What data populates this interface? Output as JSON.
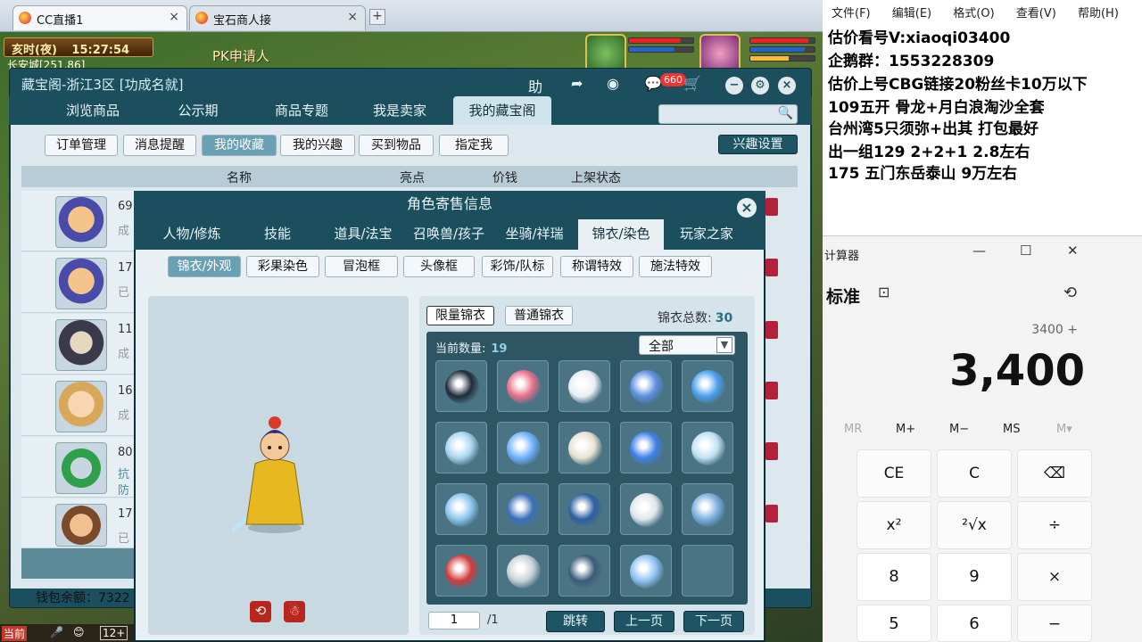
{
  "browser": {
    "tabs": [
      {
        "label": "CC直播1"
      },
      {
        "label": "宝石商人接"
      }
    ],
    "new_tab": "+",
    "close": "×"
  },
  "game": {
    "clock": {
      "period": "亥时(夜)",
      "time": "15:27:54"
    },
    "location": "长安城[251,86]",
    "pk_text": "PK申请人",
    "bottom_bar": {
      "current": "当前",
      "level": "12+"
    }
  },
  "market": {
    "title": "藏宝阁-浙江3区 [功成名就]",
    "badge_count": "660",
    "title_buttons": {
      "help": "助",
      "share": "➦",
      "stop": "◉",
      "chat": "💬",
      "cart": "🛒",
      "minimize": "−",
      "settings": "⚙",
      "close": "×"
    },
    "tabs": [
      {
        "label": "浏览商品"
      },
      {
        "label": "公示期"
      },
      {
        "label": "商品专题"
      },
      {
        "label": "我是卖家"
      },
      {
        "label": "我的藏宝阁"
      }
    ],
    "sub_buttons": [
      {
        "label": "订单管理"
      },
      {
        "label": "消息提醒"
      },
      {
        "label": "我的收藏"
      },
      {
        "label": "我的兴趣"
      },
      {
        "label": "买到物品"
      },
      {
        "label": "指定我"
      }
    ],
    "interest_settings": "兴趣设置",
    "list_headers": {
      "name": "名称",
      "highlight": "亮点",
      "price": "价钱",
      "status": "上架状态"
    },
    "rows": [
      {
        "t1": "69",
        "t2": "成"
      },
      {
        "t1": "17",
        "t2": "已"
      },
      {
        "t1": "11",
        "t2": "成"
      },
      {
        "t1": "16",
        "t2": "成"
      },
      {
        "t1": "80",
        "t2": "抗 防"
      },
      {
        "t1": "17",
        "t2": "已"
      }
    ],
    "wallet": "钱包余额：7322"
  },
  "dialog": {
    "title": "角色寄售信息",
    "close": "×",
    "tabs": [
      {
        "label": "人物/修炼"
      },
      {
        "label": "技能"
      },
      {
        "label": "道具/法宝"
      },
      {
        "label": "召唤兽/孩子"
      },
      {
        "label": "坐骑/祥瑞"
      },
      {
        "label": "锦衣/染色"
      },
      {
        "label": "玩家之家"
      }
    ],
    "subtabs": [
      {
        "label": "锦衣/外观"
      },
      {
        "label": "彩果染色"
      },
      {
        "label": "冒泡框"
      },
      {
        "label": "头像框"
      },
      {
        "label": "彩饰/队标"
      },
      {
        "label": "称谓特效"
      },
      {
        "label": "施法特效"
      }
    ],
    "preview_buttons": {
      "rotate": "⟲",
      "action": "☃"
    },
    "grid_tabs": [
      {
        "label": "限量锦衣"
      },
      {
        "label": "普通锦衣"
      }
    ],
    "total_label": "锦衣总数:",
    "total_value": "30",
    "current_label": "当前数量:",
    "current_value": "19",
    "filter_value": "全部",
    "pager": {
      "page": "1",
      "total": "/1",
      "jump": "跳转",
      "prev": "上一页",
      "next": "下一页"
    },
    "item_colors": [
      "#1e2b3a",
      "#e86f8a",
      "#e9eef2",
      "#5b8fe0",
      "#4aa0f0",
      "#a9d6f0",
      "#6fb2ff",
      "#e8e2d0",
      "#3f7fe8",
      "#bfe2f2",
      "#8ac6ee",
      "#3a6fb8",
      "#2b5fa0",
      "#dfe6ea",
      "#7bb0e0",
      "#d23a3a",
      "#c9d2d8",
      "#3b5c7a",
      "#8fc2f2",
      ""
    ]
  },
  "notepad": {
    "menu": [
      "文件(F)",
      "编辑(E)",
      "格式(O)",
      "查看(V)",
      "帮助(H)"
    ],
    "lines": [
      "估价看号V:xiaoqi03400",
      "企鹅群：1553228309",
      "估价上号CBG链接20粉丝卡10万以下",
      "109五开 骨龙+月白浪淘沙全套",
      "台州湾5只须弥+出其 打包最好",
      "出一组129 2+2+1   2.8左右",
      "175 五门东岳泰山  9万左右"
    ]
  },
  "calculator": {
    "title": "计算器",
    "window_buttons": {
      "min": "—",
      "max": "☐",
      "close": "✕"
    },
    "mode": "标准",
    "mode_icon": "⊡",
    "history_icon": "⟲",
    "expression": "3400 +",
    "display": "3,400",
    "memory": [
      "MR",
      "M+",
      "M−",
      "MS",
      "M▾"
    ],
    "keys": [
      [
        "CE",
        "C",
        "⌫"
      ],
      [
        "x²",
        "²√x",
        "÷"
      ],
      [
        "8",
        "9",
        "×"
      ],
      [
        "5",
        "6",
        "−"
      ]
    ]
  }
}
